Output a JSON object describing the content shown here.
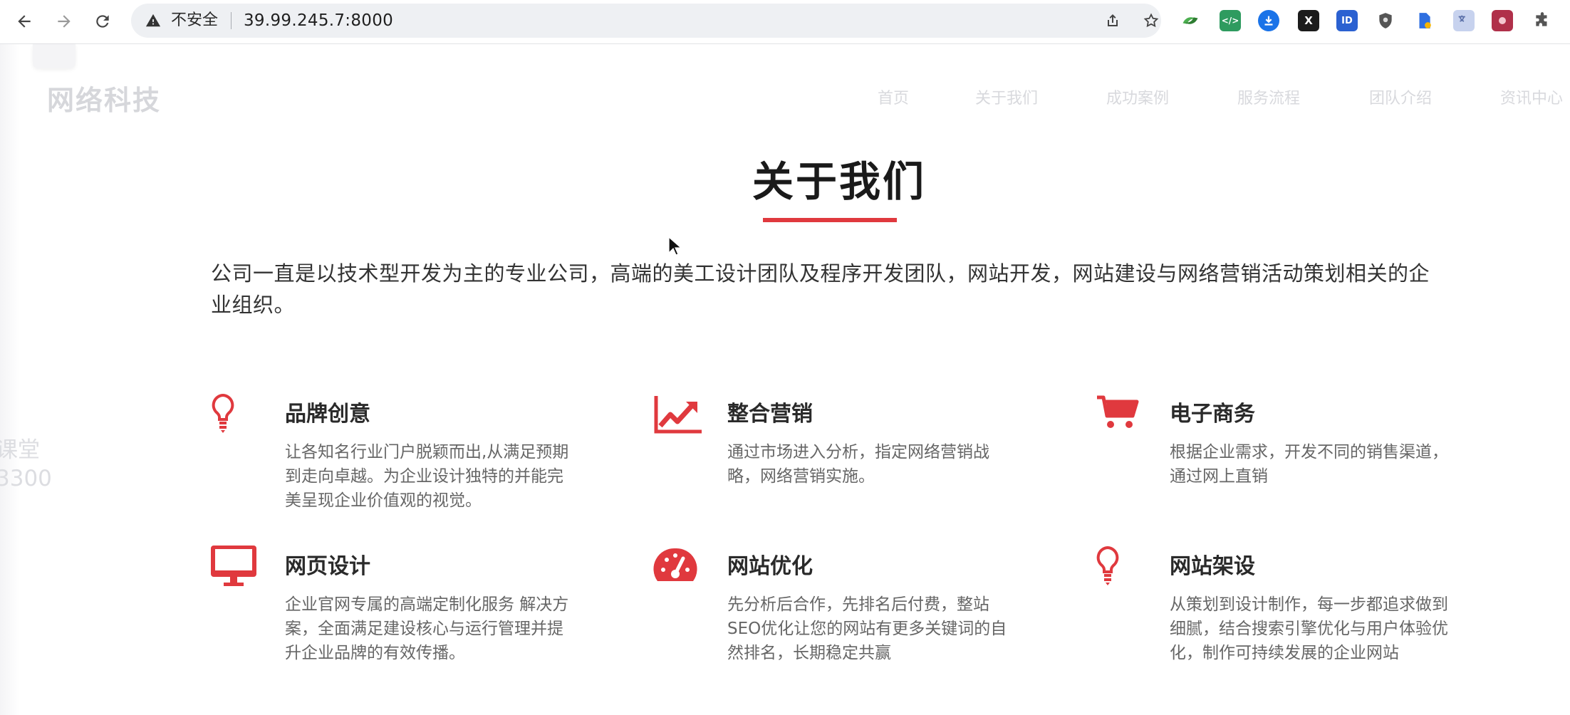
{
  "browser": {
    "security_status": "不安全",
    "url": "39.99.245.7:8000",
    "icons": [
      "back-arrow-icon",
      "forward-arrow-icon",
      "reload-icon",
      "warning-triangle-icon",
      "share-icon",
      "star-icon",
      "puzzle-extensions-icon"
    ],
    "extension_labels": {
      "code": "</>",
      "x": "X",
      "box": "ID"
    }
  },
  "site": {
    "name": "网络科技",
    "nav": [
      "首页",
      "关于我们",
      "成功案例",
      "服务流程",
      "团队介绍",
      "资讯中心"
    ]
  },
  "about": {
    "title": "关于我们",
    "intro": "公司一直是以技术型开发为主的专业公司，高端的美工设计团队及程序开发团队，网站开发，网站建设与网络营销活动策划相关的企业组织。",
    "features": [
      {
        "icon": "lightbulb-icon",
        "title": "品牌创意",
        "desc": "让各知名行业门户脱颖而出,从满足预期到走向卓越。为企业设计独特的并能完美呈现企业价值观的视觉。"
      },
      {
        "icon": "trending-chart-icon",
        "title": "整合营销",
        "desc": "通过市场进入分析，指定网络营销战略，网络营销实施。"
      },
      {
        "icon": "shopping-cart-icon",
        "title": "电子商务",
        "desc": "根据企业需求，开发不同的销售渠道，通过网上直销"
      },
      {
        "icon": "monitor-icon",
        "title": "网页设计",
        "desc": "企业官网专属的高端定制化服务 解决方案，全面满足建设核心与运行管理并提升企业品牌的有效传播。"
      },
      {
        "icon": "speedometer-icon",
        "title": "网站优化",
        "desc": "先分析后合作，先排名后付费，整站SEO优化让您的网站有更多关键词的自然排名，长期稳定共赢"
      },
      {
        "icon": "lightbulb-icon",
        "title": "网站架设",
        "desc": "从策划到设计制作，每一步都追求做到细腻，结合搜索引擎优化与用户体验优化，制作可持续发展的企业网站"
      }
    ]
  },
  "watermark": {
    "line1": "课堂",
    "line2": "3300"
  },
  "colors": {
    "accent": "#e0393e",
    "text": "#333333",
    "muted": "#666666"
  }
}
